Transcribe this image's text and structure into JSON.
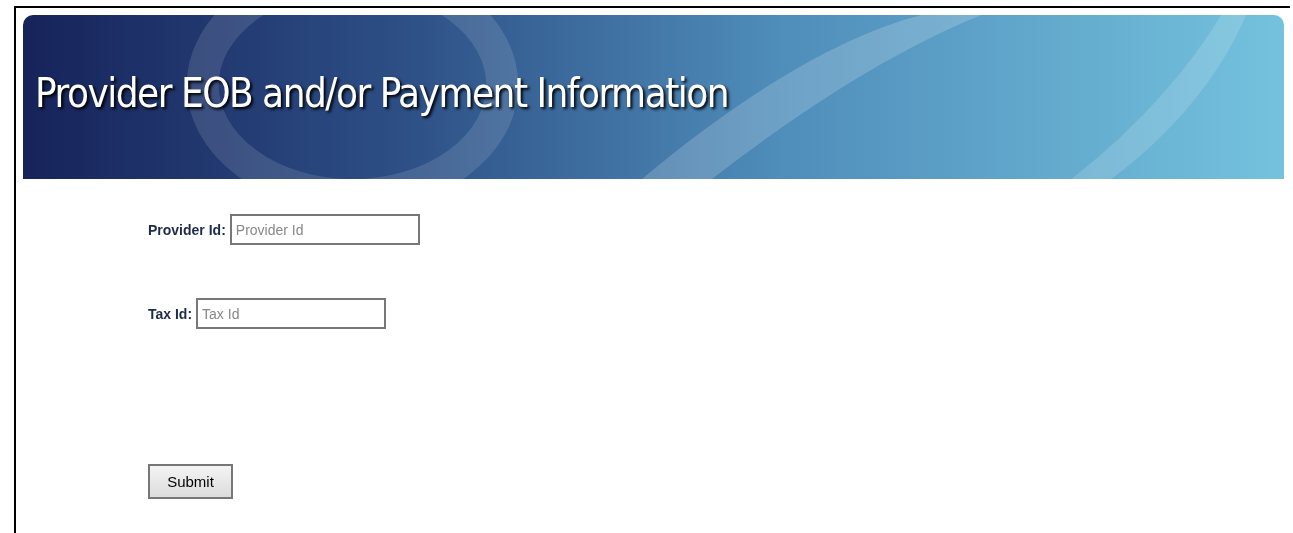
{
  "header": {
    "title": "Provider EOB and/or Payment Information"
  },
  "fields": [
    {
      "label": "Provider Id:",
      "placeholder": "Provider Id"
    },
    {
      "label": "Tax Id:",
      "placeholder": "Tax Id"
    }
  ],
  "submit_button": {
    "label": "Submit"
  }
}
